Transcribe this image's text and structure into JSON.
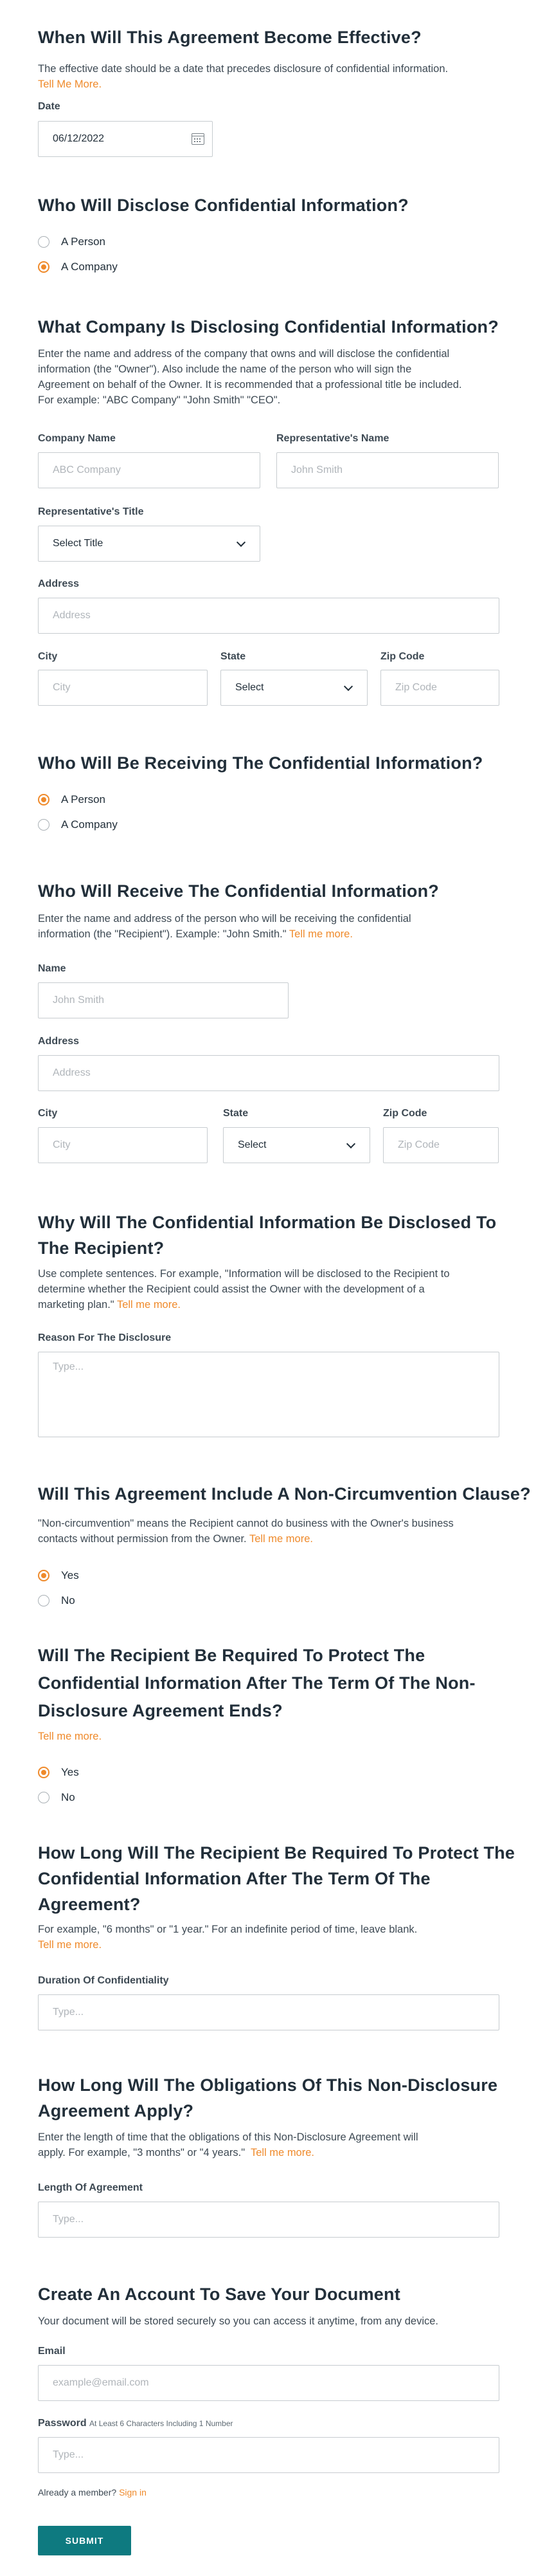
{
  "effective": {
    "title": "When Will This Agreement Become Effective?",
    "desc": "The effective date should be a date that precedes disclosure of confidential information.",
    "desc_link": "Tell Me More.",
    "date_label": "Date",
    "date_value": "06/12/2022"
  },
  "discloser_type": {
    "title": "Who Will Disclose Confidential Information?",
    "options": [
      "A Person",
      "A Company"
    ],
    "selected": "A Company"
  },
  "company": {
    "title": "What Company Is Disclosing Confidential Information?",
    "desc_lines": [
      "Enter the name and address of the company that owns and will disclose the confidential",
      "information (the \"Owner\"). Also include the name of the person who will sign the",
      "Agreement on behalf of the Owner. It is recommended that a professional title be included.",
      "For example: \"ABC Company\" \"John Smith\" \"CEO\"."
    ],
    "company_name_label": "Company Name",
    "company_name_placeholder": "ABC Company",
    "rep_name_label": "Representative's Name",
    "rep_name_placeholder": "John Smith",
    "rep_title_label": "Representative's Title",
    "rep_title_value": "Select Title",
    "address_label": "Address",
    "address_placeholder": "Address",
    "city_label": "City",
    "city_placeholder": "City",
    "state_label": "State",
    "state_value": "Select",
    "zip_label": "Zip Code",
    "zip_placeholder": "Zip Code"
  },
  "receiver_type": {
    "title": "Who Will Be Receiving The Confidential Information?",
    "options": [
      "A Person",
      "A Company"
    ],
    "selected": "A Person"
  },
  "recipient": {
    "title": "Who Will Receive The Confidential Information?",
    "desc_line1": "Enter the name and address of the person who will be receiving the confidential",
    "desc_line2": "information (the \"Recipient\"). Example: \"John Smith.\"",
    "desc_link": "Tell me more.",
    "name_label": "Name",
    "name_placeholder": "John Smith",
    "address_label": "Address",
    "address_placeholder": "Address",
    "city_label": "City",
    "city_placeholder": "City",
    "state_label": "State",
    "state_value": "Select",
    "zip_label": "Zip Code",
    "zip_placeholder": "Zip Code"
  },
  "reason": {
    "title_lines": [
      "Why Will The Confidential Information Be Disclosed To",
      "The Recipient?"
    ],
    "desc_lines": [
      "Use complete sentences. For example, \"Information will be disclosed to the Recipient to",
      "determine whether the Recipient could assist the Owner with the development of a"
    ],
    "desc_line3": "marketing plan.\"",
    "desc_link": "Tell me more.",
    "field_label": "Reason For The Disclosure",
    "field_placeholder": "Type..."
  },
  "noncircumvention": {
    "title": "Will This Agreement Include A Non-Circumvention Clause?",
    "desc_line1": "\"Non-circumvention\" means the Recipient cannot do business with the Owner's business",
    "desc_line2": "contacts without permission from the Owner.",
    "desc_link": "Tell me more.",
    "options": [
      "Yes",
      "No"
    ],
    "selected": "Yes"
  },
  "protect_after": {
    "title_lines": [
      "Will The Recipient Be Required To Protect The",
      "Confidential Information After The Term Of The Non-",
      "Disclosure Agreement Ends?"
    ],
    "desc_link": "Tell me more.",
    "options": [
      "Yes",
      "No"
    ],
    "selected": "Yes"
  },
  "duration": {
    "title_lines": [
      "How Long Will The Recipient Be Required To Protect The",
      "Confidential Information After The Term Of The",
      "Agreement?"
    ],
    "desc": "For example, \"6 months\" or \"1 year.\" For an indefinite period of time, leave blank.",
    "desc_link": "Tell me more.",
    "field_label": "Duration Of Confidentiality",
    "field_placeholder": "Type..."
  },
  "length": {
    "title_lines": [
      "How Long Will The Obligations Of This Non-Disclosure",
      "Agreement Apply?"
    ],
    "desc_line1": "Enter the length of time that the obligations of this Non-Disclosure Agreement will",
    "desc_line2": "apply. For example, \"3 months\" or \"4 years.\"",
    "desc_link": "Tell me more.",
    "field_label": "Length Of Agreement",
    "field_placeholder": "Type..."
  },
  "account": {
    "title": "Create An Account To Save Your Document",
    "desc": "Your document will be stored securely so you can access it anytime, from any device.",
    "email_label": "Email",
    "email_placeholder": "example@email.com",
    "password_label": "Password",
    "password_hint": "At Least 6 Characters Including 1 Number",
    "password_placeholder": "Type...",
    "member_text": "Already a member?",
    "signin_link": "Sign in",
    "submit_label": "SUBMIT"
  },
  "colors": {
    "accent": "#ef8a2b",
    "button": "#0e7a80",
    "text": "#222f3a"
  }
}
